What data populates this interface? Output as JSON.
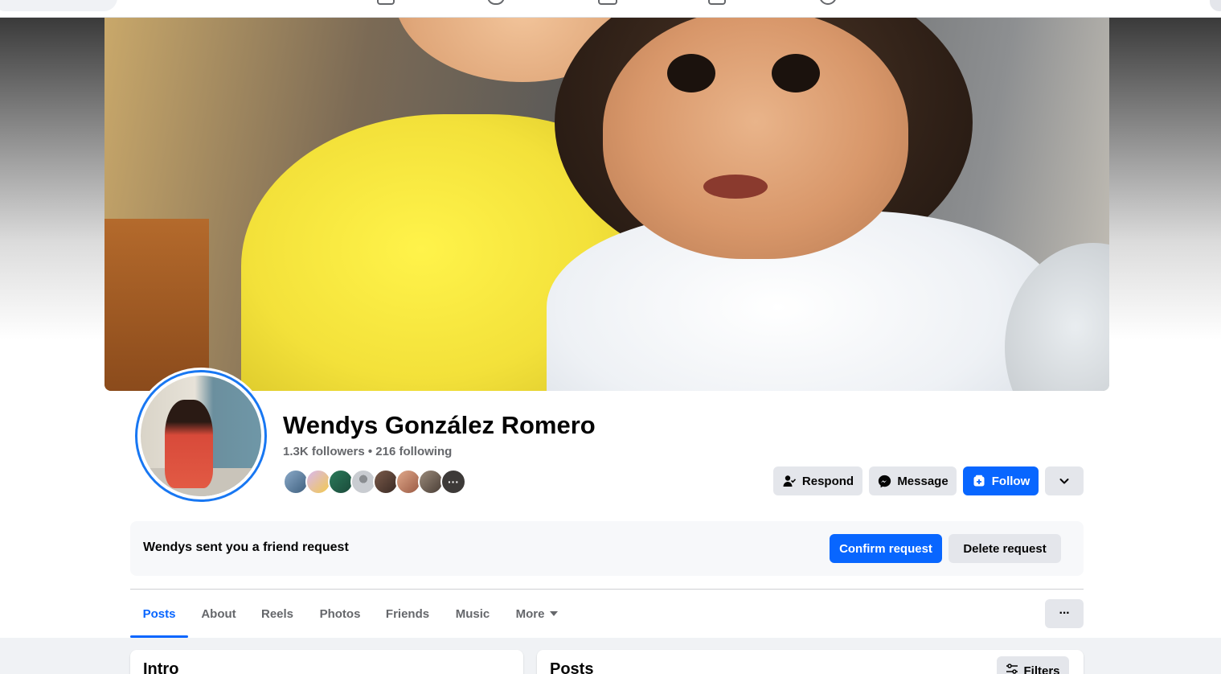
{
  "profile": {
    "name": "Wendys González Romero",
    "stats": "1.3K followers • 216 following",
    "mutual_overflow": "···"
  },
  "actions": {
    "respond": "Respond",
    "message": "Message",
    "follow": "Follow"
  },
  "friend_request": {
    "text": "Wendys sent you a friend request",
    "confirm": "Confirm request",
    "delete": "Delete request"
  },
  "tabs": [
    {
      "label": "Posts",
      "active": true
    },
    {
      "label": "About"
    },
    {
      "label": "Reels"
    },
    {
      "label": "Photos"
    },
    {
      "label": "Friends"
    },
    {
      "label": "Music"
    },
    {
      "label": "More"
    }
  ],
  "overflow_menu": "···",
  "sections": {
    "intro_title": "Intro",
    "posts_title": "Posts",
    "filters": "Filters"
  },
  "colors": {
    "accent": "#0866ff",
    "button_gray": "#e4e6eb",
    "text_secondary": "#65676b",
    "page_bg": "#f0f2f5"
  }
}
